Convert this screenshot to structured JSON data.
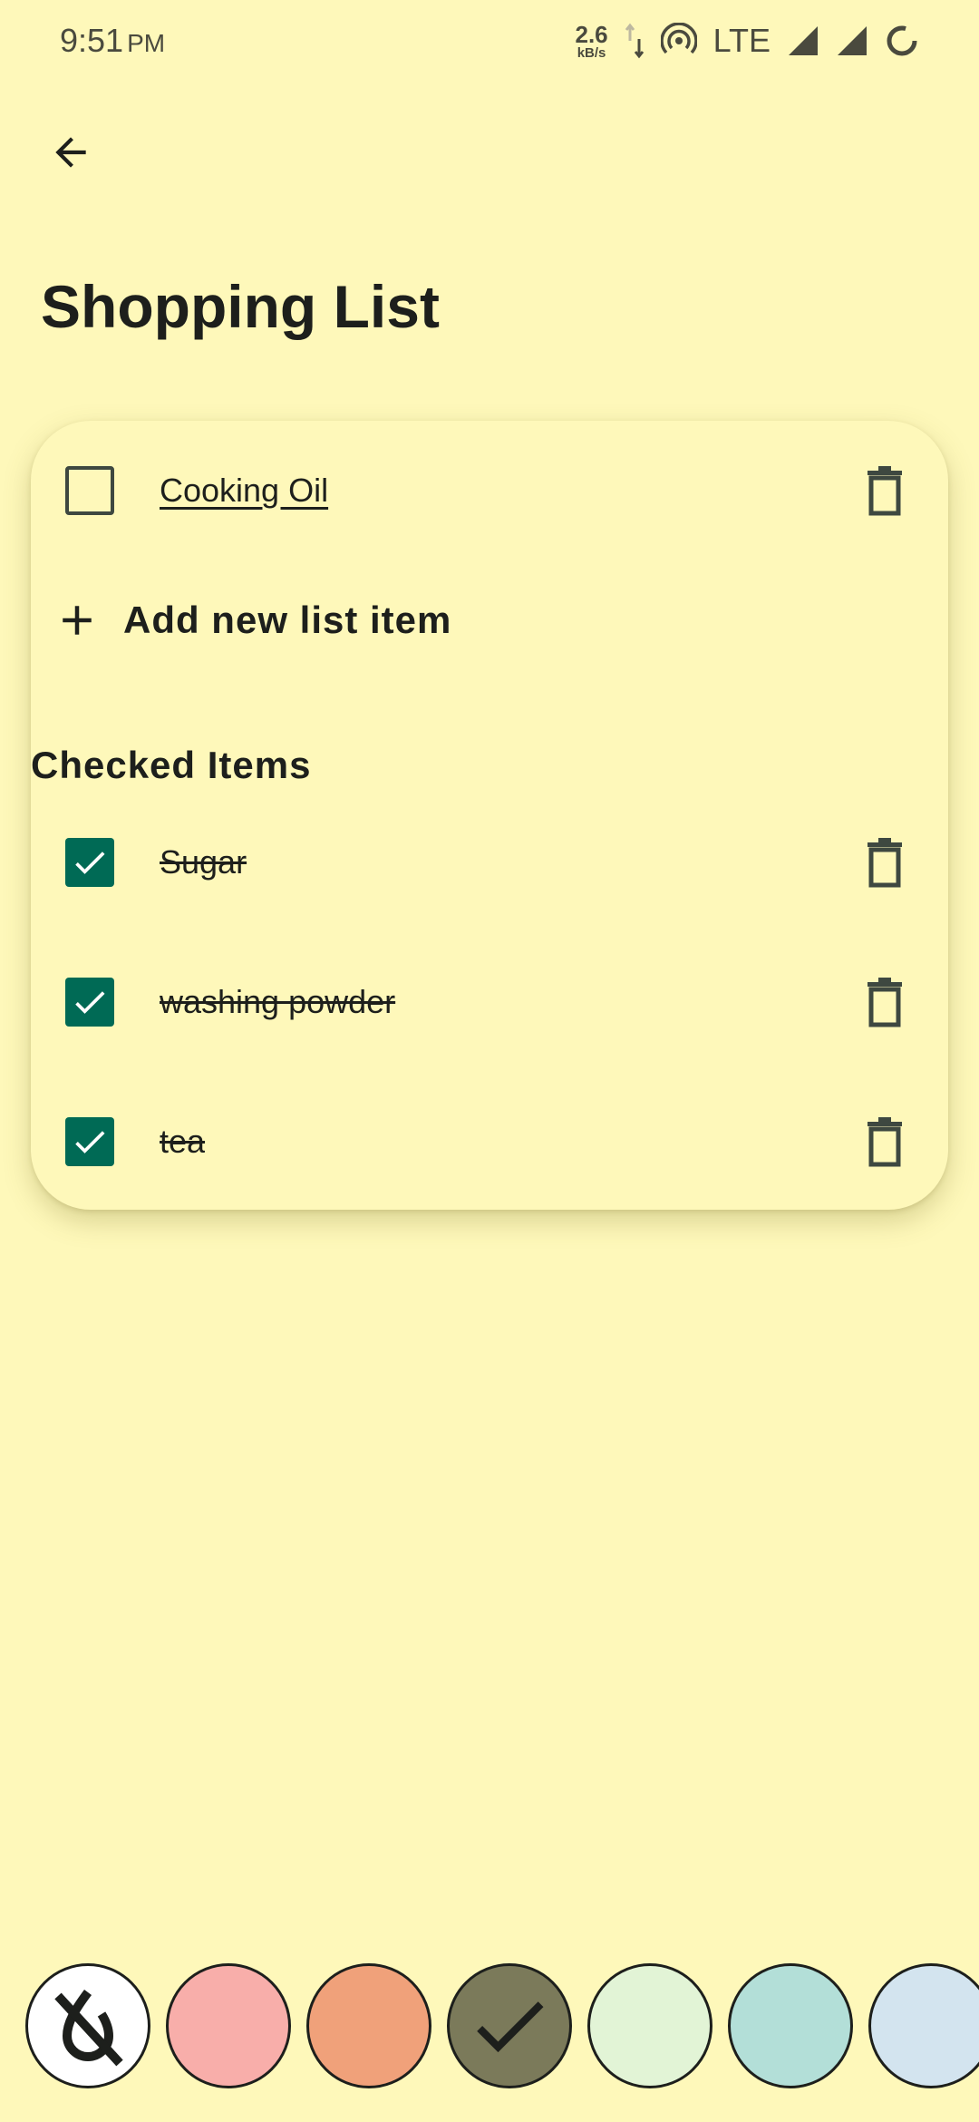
{
  "status_bar": {
    "time": "9:51",
    "ampm": "PM",
    "net_speed": "2.6",
    "net_unit": "kB/s",
    "network": "LTE",
    "icons": [
      "data-arrows-icon",
      "hotspot-icon",
      "signal-icon",
      "signal-icon",
      "battery-saver-icon"
    ]
  },
  "page": {
    "title": "Shopping List",
    "back_icon": "arrow-back-icon"
  },
  "list": {
    "unchecked_items": [
      {
        "label": "Cooking Oil",
        "checked": false
      }
    ],
    "add_label": "Add new list item",
    "checked_section_title": "Checked Items",
    "checked_items": [
      {
        "label": "Sugar",
        "checked": true
      },
      {
        "label": "washing powder",
        "checked": true
      },
      {
        "label": "tea",
        "checked": true
      }
    ]
  },
  "colors": {
    "background": "#fef8ba",
    "accent": "#006a55",
    "swatches": [
      {
        "name": "no-color",
        "color": "#ffffff",
        "selected": false
      },
      {
        "name": "red",
        "color": "#f8aeaa",
        "selected": false
      },
      {
        "name": "orange",
        "color": "#f0a17a",
        "selected": false
      },
      {
        "name": "olive",
        "color": "#7b7a5a",
        "selected": true
      },
      {
        "name": "green",
        "color": "#e2f4d6",
        "selected": false
      },
      {
        "name": "teal",
        "color": "#b3dfd8",
        "selected": false
      },
      {
        "name": "blue",
        "color": "#d3e4ef",
        "selected": false
      }
    ]
  }
}
